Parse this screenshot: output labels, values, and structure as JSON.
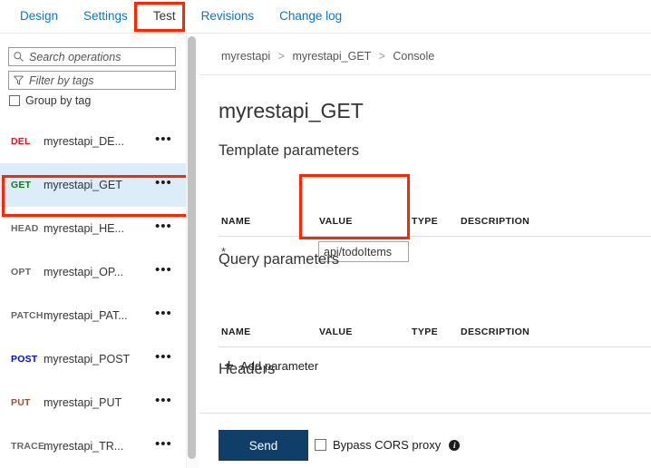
{
  "tabs": [
    {
      "label": "Design",
      "active": false
    },
    {
      "label": "Settings",
      "active": false
    },
    {
      "label": "Test",
      "active": true
    },
    {
      "label": "Revisions",
      "active": false
    },
    {
      "label": "Change log",
      "active": false
    }
  ],
  "sidebar": {
    "search": {
      "placeholder": "Search operations",
      "value": "",
      "icon": "search-icon"
    },
    "filter": {
      "placeholder": "Filter by tags",
      "value": "",
      "icon": "funnel-icon"
    },
    "group_by_tag": {
      "label": "Group by tag",
      "checked": false
    },
    "operations": [
      {
        "verb": "DEL",
        "verb_color": "#e81123",
        "name": "myrestapi_DE...",
        "selected": false,
        "menu": "•••"
      },
      {
        "verb": "GET",
        "verb_color": "#107c10",
        "name": "myrestapi_GET",
        "selected": true,
        "menu": "•••"
      },
      {
        "verb": "HEAD",
        "verb_color": "#666666",
        "name": "myrestapi_HE...",
        "selected": false,
        "menu": "•••"
      },
      {
        "verb": "OPT",
        "verb_color": "#666666",
        "name": "myrestapi_OP...",
        "selected": false,
        "menu": "•••"
      },
      {
        "verb": "PATCH",
        "verb_color": "#666666",
        "name": "myrestapi_PAT...",
        "selected": false,
        "menu": "•••"
      },
      {
        "verb": "POST",
        "verb_color": "#0000ff",
        "name": "myrestapi_POST",
        "selected": false,
        "menu": "•••"
      },
      {
        "verb": "PUT",
        "verb_color": "#a0522d",
        "name": "myrestapi_PUT",
        "selected": false,
        "menu": "•••"
      },
      {
        "verb": "TRACE",
        "verb_color": "#666666",
        "name": "myrestapi_TR...",
        "selected": false,
        "menu": "•••"
      }
    ]
  },
  "breadcrumb": {
    "root": "myrestapi",
    "sep1": ">",
    "operation": "myrestapi_GET",
    "sep2": ">",
    "leaf": "Console"
  },
  "main": {
    "title": "myrestapi_GET",
    "template_parameters": {
      "heading": "Template parameters",
      "columns": [
        "NAME",
        "VALUE",
        "TYPE",
        "DESCRIPTION"
      ],
      "rows": [
        {
          "name": "*",
          "value": "api/todoItems",
          "type": "",
          "description": ""
        }
      ]
    },
    "query_parameters": {
      "heading": "Query parameters",
      "columns": [
        "NAME",
        "VALUE",
        "TYPE",
        "DESCRIPTION"
      ],
      "rows": [],
      "add_label": "Add parameter",
      "add_icon": "plus-icon"
    },
    "headers": {
      "heading": "Headers"
    },
    "footer": {
      "send_label": "Send",
      "bypass_label": "Bypass CORS proxy",
      "bypass_checked": false,
      "info_icon": "info-icon",
      "info_glyph": "i"
    }
  },
  "annotations": {
    "highlight_color": "#ff2600",
    "targets": [
      "tab-test",
      "sidebar-operation-get",
      "template-value-column"
    ]
  },
  "colors": {
    "accent_link": "#0078d4",
    "send_button_bg": "#0f3e69",
    "selected_row_bg": "#dcedf9",
    "highlight": "#ff2600"
  }
}
